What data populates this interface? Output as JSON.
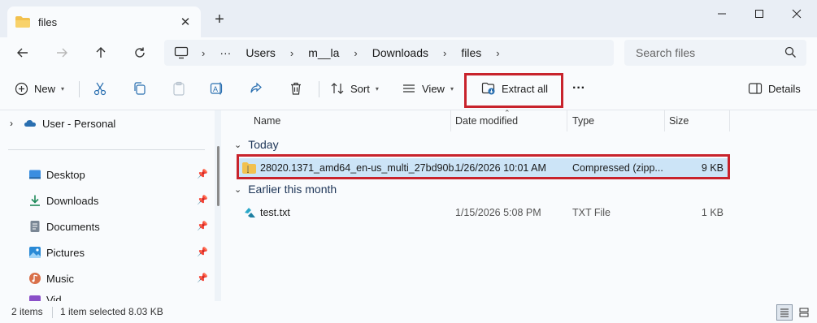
{
  "tab": {
    "title": "files"
  },
  "address": {
    "segments": [
      "Users",
      "m__la",
      "Downloads",
      "files"
    ],
    "search_placeholder": "Search files"
  },
  "commands": {
    "new": "New",
    "sort": "Sort",
    "view": "View",
    "extract_all": "Extract all",
    "more": "···",
    "details": "Details"
  },
  "sidebar": {
    "cloud": "User - Personal",
    "items": [
      "Desktop",
      "Downloads",
      "Documents",
      "Pictures",
      "Music",
      "Vid"
    ]
  },
  "columns": {
    "name": "Name",
    "date": "Date modified",
    "type": "Type",
    "size": "Size"
  },
  "groups": [
    {
      "label": "Today",
      "files": [
        {
          "name": "28020.1371_amd64_en-us_multi_27bd90b...",
          "date": "1/26/2026 10:01 AM",
          "type": "Compressed (zipp...",
          "size": "9 KB"
        }
      ]
    },
    {
      "label": "Earlier this month",
      "files": [
        {
          "name": "test.txt",
          "date": "1/15/2026 5:08 PM",
          "type": "TXT File",
          "size": "1 KB"
        }
      ]
    }
  ],
  "status": {
    "items": "2 items",
    "selected": "1 item selected",
    "selected_size": "8.03 KB"
  },
  "colors": {
    "highlight": "#c8232c",
    "selection": "#cce4f7",
    "folder": "#f2c14e"
  }
}
